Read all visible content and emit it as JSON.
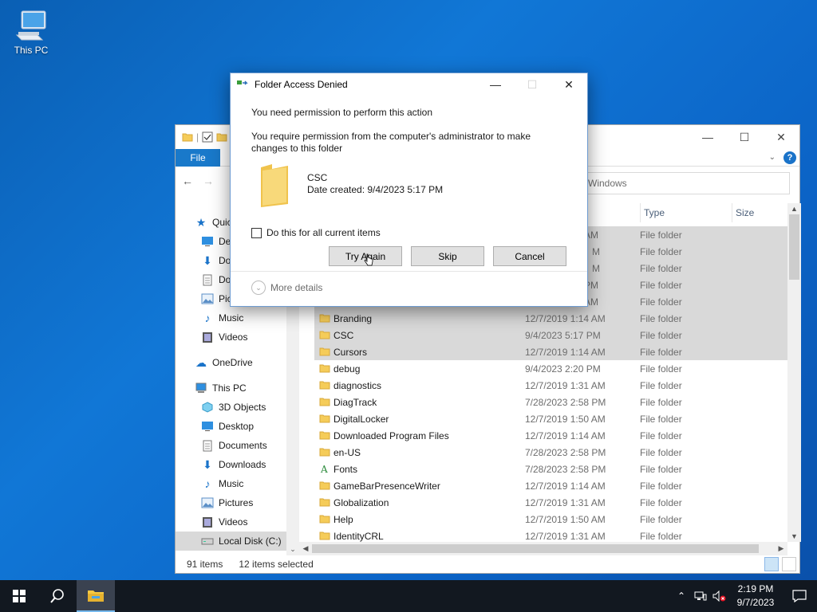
{
  "desktop": {
    "this_pc_label": "This PC"
  },
  "explorer": {
    "ribbon": {
      "file_tab": "File"
    },
    "search_placeholder": "Search Windows",
    "search_visible_text": "Windows",
    "nav": {
      "items": [
        {
          "label": "Quick access",
          "visible": "Quic",
          "icon": "star-icon"
        },
        {
          "label": "Desktop",
          "visible": "Des",
          "icon": "desktop-icon"
        },
        {
          "label": "Downloads",
          "visible": "Dov",
          "icon": "download-arrow-icon"
        },
        {
          "label": "Documents",
          "visible": "Doc",
          "icon": "document-icon"
        },
        {
          "label": "Pictures",
          "visible": "Pict",
          "icon": "pictures-icon"
        },
        {
          "label": "Music",
          "visible": "Music",
          "icon": "music-note-icon"
        },
        {
          "label": "Videos",
          "visible": "Videos",
          "icon": "film-icon"
        },
        {
          "label": "OneDrive",
          "visible": "OneDrive",
          "icon": "cloud-icon"
        },
        {
          "label": "This PC",
          "visible": "This PC",
          "icon": "computer-icon"
        },
        {
          "label": "3D Objects",
          "visible": "3D Objects",
          "icon": "cube-icon"
        },
        {
          "label": "Desktop",
          "visible": "Desktop",
          "icon": "desktop-icon"
        },
        {
          "label": "Documents",
          "visible": "Documents",
          "icon": "document-icon"
        },
        {
          "label": "Downloads",
          "visible": "Downloads",
          "icon": "download-arrow-icon"
        },
        {
          "label": "Music",
          "visible": "Music",
          "icon": "music-note-icon"
        },
        {
          "label": "Pictures",
          "visible": "Pictures",
          "icon": "pictures-icon"
        },
        {
          "label": "Videos",
          "visible": "Videos",
          "icon": "film-icon"
        },
        {
          "label": "Local Disk (C:)",
          "visible": "Local Disk (C:)",
          "icon": "drive-icon"
        }
      ]
    },
    "columns": {
      "type": "Type",
      "size": "Size"
    },
    "hidden_rows": [
      {
        "date_tail": "AM",
        "type": "File folder"
      },
      {
        "date_tail": "M",
        "type": "File folder"
      },
      {
        "date_tail": "M",
        "type": "File folder"
      },
      {
        "date_tail": "PM",
        "type": "File folder"
      },
      {
        "date_tail": "AM",
        "type": "File folder"
      }
    ],
    "files": [
      {
        "name": "Branding",
        "date": "12/7/2019 1:14 AM",
        "type": "File folder",
        "selected": true
      },
      {
        "name": "CSC",
        "date": "9/4/2023 5:17 PM",
        "type": "File folder",
        "selected": true
      },
      {
        "name": "Cursors",
        "date": "12/7/2019 1:14 AM",
        "type": "File folder",
        "selected": true
      },
      {
        "name": "debug",
        "date": "9/4/2023 2:20 PM",
        "type": "File folder",
        "selected": false
      },
      {
        "name": "diagnostics",
        "date": "12/7/2019 1:31 AM",
        "type": "File folder",
        "selected": false
      },
      {
        "name": "DiagTrack",
        "date": "7/28/2023 2:58 PM",
        "type": "File folder",
        "selected": false
      },
      {
        "name": "DigitalLocker",
        "date": "12/7/2019 1:50 AM",
        "type": "File folder",
        "selected": false
      },
      {
        "name": "Downloaded Program Files",
        "date": "12/7/2019 1:14 AM",
        "type": "File folder",
        "selected": false
      },
      {
        "name": "en-US",
        "date": "7/28/2023 2:58 PM",
        "type": "File folder",
        "selected": false
      },
      {
        "name": "Fonts",
        "date": "7/28/2023 2:58 PM",
        "type": "File folder",
        "selected": false,
        "icon": "fonts-folder-icon"
      },
      {
        "name": "GameBarPresenceWriter",
        "date": "12/7/2019 1:14 AM",
        "type": "File folder",
        "selected": false
      },
      {
        "name": "Globalization",
        "date": "12/7/2019 1:31 AM",
        "type": "File folder",
        "selected": false
      },
      {
        "name": "Help",
        "date": "12/7/2019 1:50 AM",
        "type": "File folder",
        "selected": false
      },
      {
        "name": "IdentityCRL",
        "date": "12/7/2019 1:31 AM",
        "type": "File folder",
        "selected": false
      }
    ],
    "status": {
      "item_count": "91 items",
      "selected_count": "12 items selected"
    }
  },
  "dialog": {
    "title": "Folder Access Denied",
    "heading": "You need permission to perform this action",
    "message_line1": "You require permission from the computer's administrator to make",
    "message_line2": "changes to this folder",
    "folder_name": "CSC",
    "folder_date": "Date created: 9/4/2023 5:17 PM",
    "checkbox_label": "Do this for all current items",
    "checkbox_checked": false,
    "buttons": {
      "try_again": "Try Again",
      "skip": "Skip",
      "cancel": "Cancel"
    },
    "more_details": "More details"
  },
  "taskbar": {
    "time": "2:19 PM",
    "date": "9/7/2023",
    "accent": "#76b9ed"
  },
  "colors": {
    "desktop_bg": "#0b63c6",
    "selection": "#d9d9d9",
    "file_tab": "#1979ca",
    "folder_yellow": "#f5cc59"
  }
}
